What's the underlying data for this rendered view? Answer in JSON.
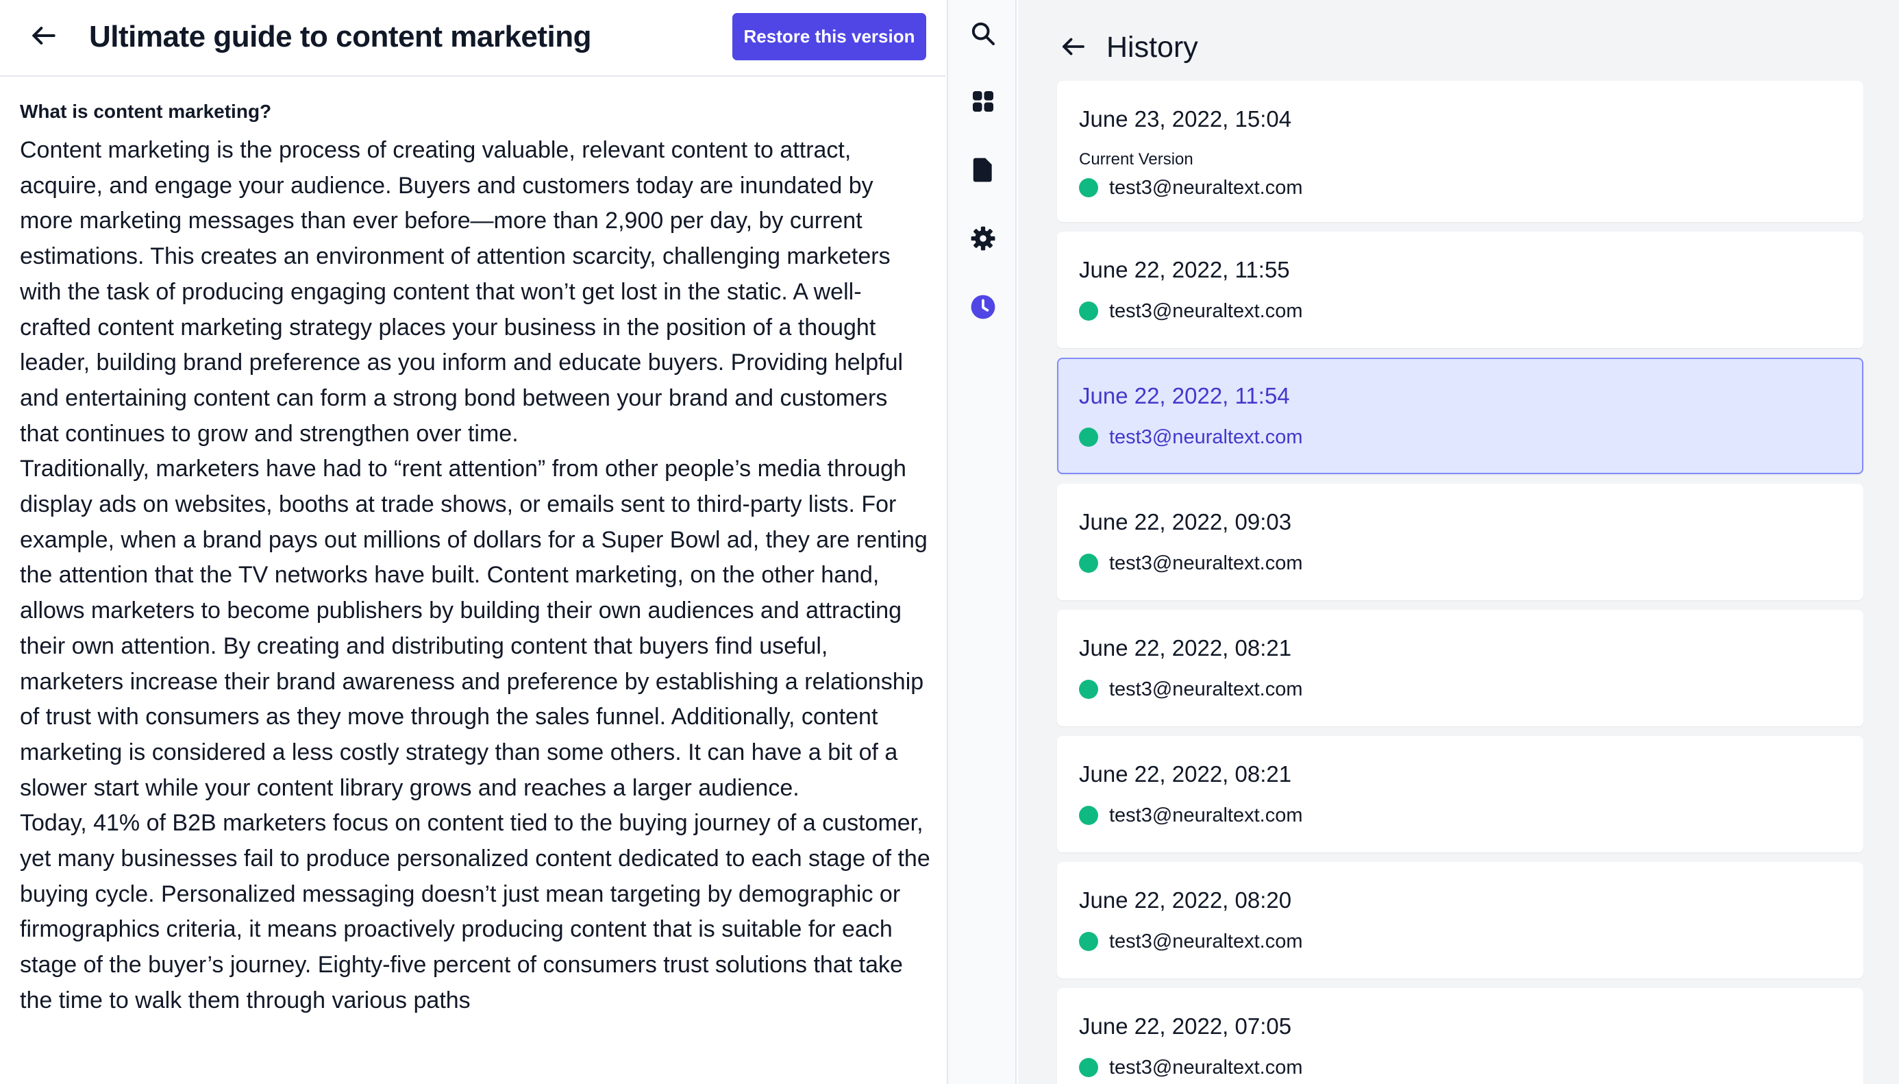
{
  "colors": {
    "accent": "#4f46e5",
    "selected_bg": "#e0e7ff",
    "status_dot": "#10b981",
    "panel_bg": "#f3f4f6"
  },
  "editor": {
    "title": "Ultimate guide to content marketing",
    "restore_label": "Restore this version",
    "heading": "What is content marketing?",
    "paragraphs": [
      "Content marketing is the process of creating valuable, relevant content to attract, acquire, and engage your audience. Buyers and customers today are inundated by more marketing messages than ever before—more than 2,900 per day, by current estimations. This creates an environment of attention scarcity, challenging marketers with the task of producing engaging content that won’t get lost in the static. A well-crafted content marketing strategy places your business in the position of a thought leader, building brand preference as you inform and educate buyers. Providing helpful and entertaining content can form a strong bond between your brand and customers that continues to grow and strengthen over time.",
      "Traditionally, marketers have had to “rent attention” from other people’s media through display ads on websites, booths at trade shows, or emails sent to third-party lists. For example, when a brand pays out millions of dollars for a Super Bowl ad, they are renting the attention that the TV networks have built. Content marketing, on the other hand, allows marketers to become publishers by building their own audiences and attracting their own attention. By creating and distributing content that buyers find useful, marketers increase their brand awareness and preference by establishing a relationship of trust with consumers as they move through the sales funnel. Additionally, content marketing is considered a less costly strategy than some others. It can have a bit of a slower start while your content library grows and reaches a larger audience.",
      "Today, 41% of B2B marketers focus on content tied to the buying journey of a customer, yet many businesses fail to produce personalized content dedicated to each stage of the buying cycle. Personalized messaging doesn’t just mean targeting by demographic or firmographics criteria, it means proactively producing content that is suitable for each stage of the buyer’s journey. Eighty-five percent of consumers trust solutions that take the time to walk them through various paths"
    ]
  },
  "rail": {
    "icons": [
      "search-icon",
      "grid-icon",
      "document-icon",
      "gear-icon",
      "clock-icon"
    ],
    "active": "clock-icon"
  },
  "history": {
    "title": "History",
    "versions": [
      {
        "date": "June 23, 2022, 15:04",
        "current_label": "Current Version",
        "user": "test3@neuraltext.com"
      },
      {
        "date": "June 22, 2022, 11:55",
        "user": "test3@neuraltext.com"
      },
      {
        "date": "June 22, 2022, 11:54",
        "user": "test3@neuraltext.com",
        "selected": true
      },
      {
        "date": "June 22, 2022, 09:03",
        "user": "test3@neuraltext.com"
      },
      {
        "date": "June 22, 2022, 08:21",
        "user": "test3@neuraltext.com"
      },
      {
        "date": "June 22, 2022, 08:21",
        "user": "test3@neuraltext.com"
      },
      {
        "date": "June 22, 2022, 08:20",
        "user": "test3@neuraltext.com"
      },
      {
        "date": "June 22, 2022, 07:05",
        "user": "test3@neuraltext.com"
      }
    ]
  }
}
